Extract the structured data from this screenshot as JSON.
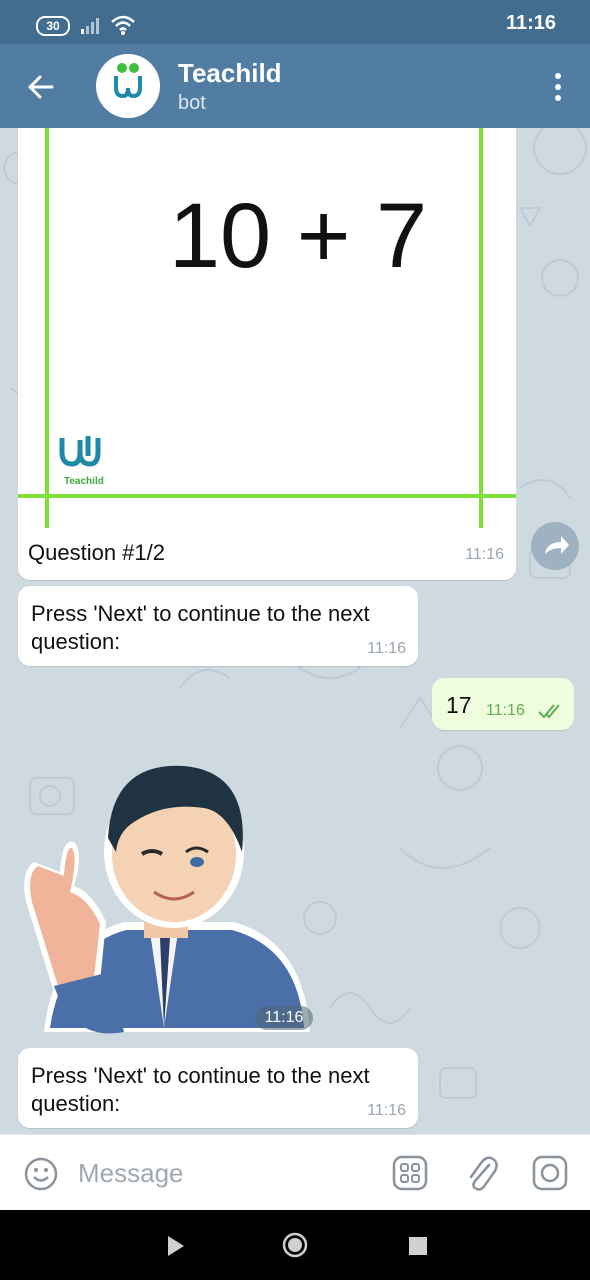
{
  "status_bar": {
    "battery": "30",
    "time": "11:16"
  },
  "header": {
    "title": "Teachild",
    "subtitle": "bot",
    "logo_text": "Teachild"
  },
  "messages": {
    "image_card": {
      "expression": "10 + 7",
      "logo_text": "Teachild",
      "caption": "Question #1/2",
      "time": "11:16"
    },
    "prompt1": {
      "text": "Press 'Next' to continue to the next question:",
      "time": "11:16"
    },
    "answer": {
      "text": "17",
      "time": "11:16"
    },
    "sticker": {
      "time": "11:16"
    },
    "prompt2": {
      "text": "Press 'Next' to continue to the next question:",
      "time": "11:16"
    }
  },
  "input": {
    "placeholder": "Message"
  },
  "colors": {
    "header": "#527da3",
    "status": "#426d8f",
    "accent_green": "#7fe03a",
    "outgoing": "#effdde"
  }
}
